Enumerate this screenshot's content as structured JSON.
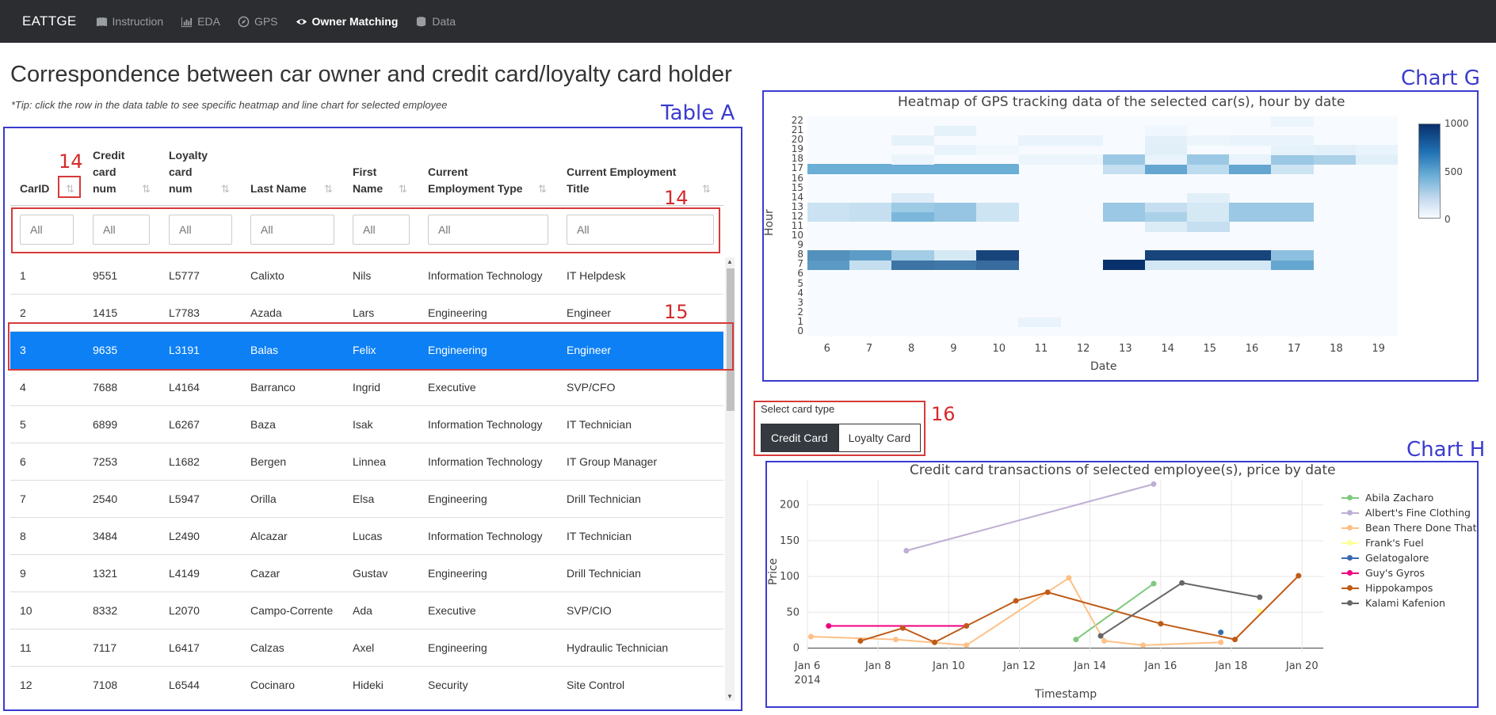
{
  "navbar": {
    "brand": "EATTGE",
    "items": [
      {
        "label": "Instruction",
        "icon": "book-icon",
        "active": false
      },
      {
        "label": "EDA",
        "icon": "chart-icon",
        "active": false
      },
      {
        "label": "GPS",
        "icon": "compass-icon",
        "active": false
      },
      {
        "label": "Owner Matching",
        "icon": "eye-icon",
        "active": true
      },
      {
        "label": "Data",
        "icon": "database-icon",
        "active": false
      }
    ]
  },
  "page": {
    "title": "Correspondence between car owner and credit card/loyalty card holder",
    "tip": "*Tip: click the row in the data table to see specific heatmap and line chart for selected employee"
  },
  "annotations": {
    "table_a": "Table A",
    "chart_g": "Chart G",
    "chart_h": "Chart H",
    "n14a": "14",
    "n14b": "14",
    "n15": "15",
    "n16": "16"
  },
  "table": {
    "columns": [
      {
        "label": "CarID"
      },
      {
        "label": "Credit card num"
      },
      {
        "label": "Loyalty card num"
      },
      {
        "label": "Last Name"
      },
      {
        "label": "First Name"
      },
      {
        "label": "Current Employment Type"
      },
      {
        "label": "Current Employment Title"
      }
    ],
    "filter_placeholder": "All",
    "selected_row": 2,
    "rows": [
      [
        "1",
        "9551",
        "L5777",
        "Calixto",
        "Nils",
        "Information Technology",
        "IT Helpdesk"
      ],
      [
        "2",
        "1415",
        "L7783",
        "Azada",
        "Lars",
        "Engineering",
        "Engineer"
      ],
      [
        "3",
        "9635",
        "L3191",
        "Balas",
        "Felix",
        "Engineering",
        "Engineer"
      ],
      [
        "4",
        "7688",
        "L4164",
        "Barranco",
        "Ingrid",
        "Executive",
        "SVP/CFO"
      ],
      [
        "5",
        "6899",
        "L6267",
        "Baza",
        "Isak",
        "Information Technology",
        "IT Technician"
      ],
      [
        "6",
        "7253",
        "L1682",
        "Bergen",
        "Linnea",
        "Information Technology",
        "IT Group Manager"
      ],
      [
        "7",
        "2540",
        "L5947",
        "Orilla",
        "Elsa",
        "Engineering",
        "Drill Technician"
      ],
      [
        "8",
        "3484",
        "L2490",
        "Alcazar",
        "Lucas",
        "Information Technology",
        "IT Technician"
      ],
      [
        "9",
        "1321",
        "L4149",
        "Cazar",
        "Gustav",
        "Engineering",
        "Drill Technician"
      ],
      [
        "10",
        "8332",
        "L2070",
        "Campo-Corrente",
        "Ada",
        "Executive",
        "SVP/CIO"
      ],
      [
        "11",
        "7117",
        "L6417",
        "Calzas",
        "Axel",
        "Engineering",
        "Hydraulic Technician"
      ],
      [
        "12",
        "7108",
        "L6544",
        "Cocinaro",
        "Hideki",
        "Security",
        "Site Control"
      ]
    ]
  },
  "card_select": {
    "label": "Select card type",
    "options": [
      "Credit Card",
      "Loyalty Card"
    ],
    "selected": "Credit Card"
  },
  "chart_data": [
    {
      "type": "heatmap",
      "title": "Heatmap of GPS tracking data of the selected car(s), hour by date",
      "xlabel": "Date",
      "ylabel": "Hour",
      "x": [
        6,
        7,
        8,
        9,
        10,
        11,
        12,
        13,
        14,
        15,
        16,
        17,
        18,
        19
      ],
      "y": [
        0,
        1,
        2,
        3,
        4,
        5,
        6,
        7,
        8,
        9,
        10,
        11,
        12,
        13,
        14,
        15,
        16,
        17,
        18,
        19,
        20,
        21,
        22
      ],
      "colorscale": [
        "#f7fbff",
        "#08306b"
      ],
      "zrange": [
        0,
        1000
      ],
      "colorbar_ticks": [
        "1000",
        "500",
        "0"
      ],
      "z": [
        [
          0,
          0,
          0,
          0,
          0,
          0,
          0,
          0,
          0,
          0,
          0,
          0,
          0,
          0
        ],
        [
          0,
          0,
          0,
          0,
          0,
          50,
          0,
          0,
          0,
          0,
          0,
          0,
          0,
          0
        ],
        [
          0,
          0,
          0,
          0,
          0,
          0,
          0,
          0,
          0,
          0,
          0,
          0,
          0,
          0
        ],
        [
          0,
          0,
          0,
          0,
          0,
          0,
          0,
          0,
          0,
          0,
          0,
          0,
          0,
          0
        ],
        [
          0,
          0,
          0,
          0,
          0,
          0,
          0,
          0,
          0,
          0,
          0,
          0,
          0,
          0
        ],
        [
          0,
          0,
          0,
          0,
          0,
          0,
          0,
          0,
          0,
          0,
          0,
          0,
          0,
          0
        ],
        [
          0,
          0,
          0,
          0,
          0,
          0,
          0,
          0,
          0,
          0,
          0,
          0,
          0,
          0
        ],
        [
          580,
          180,
          730,
          720,
          760,
          0,
          0,
          1000,
          130,
          130,
          130,
          530,
          0,
          0
        ],
        [
          620,
          570,
          300,
          120,
          920,
          0,
          0,
          0,
          920,
          920,
          920,
          380,
          0,
          0
        ],
        [
          0,
          0,
          0,
          0,
          0,
          0,
          0,
          0,
          0,
          0,
          0,
          0,
          0,
          0
        ],
        [
          0,
          0,
          0,
          0,
          0,
          0,
          0,
          0,
          0,
          0,
          0,
          0,
          0,
          0
        ],
        [
          0,
          0,
          0,
          0,
          0,
          0,
          0,
          0,
          100,
          180,
          0,
          0,
          0,
          0
        ],
        [
          160,
          180,
          440,
          350,
          150,
          0,
          0,
          330,
          270,
          120,
          330,
          330,
          0,
          0
        ],
        [
          160,
          180,
          320,
          350,
          150,
          0,
          0,
          330,
          180,
          120,
          330,
          330,
          0,
          0
        ],
        [
          0,
          0,
          90,
          0,
          0,
          0,
          0,
          0,
          0,
          80,
          0,
          0,
          0,
          0
        ],
        [
          0,
          0,
          0,
          0,
          0,
          0,
          0,
          0,
          0,
          0,
          0,
          0,
          0,
          0
        ],
        [
          0,
          0,
          0,
          0,
          0,
          0,
          0,
          0,
          0,
          0,
          0,
          0,
          0,
          0
        ],
        [
          500,
          500,
          500,
          500,
          500,
          0,
          0,
          180,
          530,
          210,
          530,
          150,
          0,
          0
        ],
        [
          0,
          0,
          40,
          0,
          0,
          40,
          40,
          330,
          50,
          330,
          50,
          330,
          270,
          80
        ],
        [
          0,
          0,
          0,
          50,
          20,
          0,
          0,
          0,
          80,
          0,
          0,
          60,
          70,
          50
        ],
        [
          0,
          0,
          60,
          0,
          0,
          50,
          50,
          0,
          70,
          40,
          50,
          50,
          0,
          0
        ],
        [
          0,
          0,
          0,
          60,
          0,
          0,
          0,
          0,
          30,
          0,
          0,
          0,
          0,
          0
        ],
        [
          0,
          0,
          0,
          0,
          0,
          0,
          0,
          0,
          0,
          0,
          0,
          40,
          0,
          0
        ]
      ]
    },
    {
      "type": "line",
      "title": "Credit card transactions of selected employee(s), price by date",
      "xlabel": "Timestamp",
      "ylabel": "Price",
      "x_ticks": [
        "Jan 6",
        "Jan 8",
        "Jan 10",
        "Jan 12",
        "Jan 14",
        "Jan 16",
        "Jan 18",
        "Jan 20"
      ],
      "x_tick_sub": "2014",
      "x_range": [
        6,
        20.6
      ],
      "y_ticks": [
        0,
        50,
        100,
        150,
        200
      ],
      "y_range": [
        -5,
        235
      ],
      "series": [
        {
          "name": "Abila Zacharo",
          "color": "#7fc97f",
          "points": [
            [
              13.6,
              12
            ],
            [
              15.8,
              90
            ]
          ]
        },
        {
          "name": "Albert's Fine Clothing",
          "color": "#beaed4",
          "points": [
            [
              8.8,
              136
            ],
            [
              15.8,
              229
            ]
          ]
        },
        {
          "name": "Bean There Done That",
          "color": "#fdc086",
          "points": [
            [
              6.1,
              16
            ],
            [
              8.5,
              12
            ],
            [
              10.5,
              4
            ],
            [
              13.4,
              98
            ],
            [
              14.4,
              10
            ],
            [
              15.5,
              4
            ],
            [
              17.7,
              8
            ]
          ]
        },
        {
          "name": "Frank's Fuel",
          "color": "#ffff99",
          "points": [
            [
              18.8,
              52
            ]
          ]
        },
        {
          "name": "Gelatogalore",
          "color": "#386cb0",
          "points": [
            [
              17.7,
              22
            ]
          ]
        },
        {
          "name": "Guy's Gyros",
          "color": "#f0027f",
          "points": [
            [
              6.6,
              31
            ],
            [
              10.5,
              31
            ]
          ]
        },
        {
          "name": "Hippokampos",
          "color": "#bf5b17",
          "points": [
            [
              7.5,
              10
            ],
            [
              8.7,
              28
            ],
            [
              9.6,
              8
            ],
            [
              10.5,
              31
            ],
            [
              11.9,
              66
            ],
            [
              12.8,
              78
            ],
            [
              16.0,
              34
            ],
            [
              18.1,
              12
            ],
            [
              19.9,
              101
            ]
          ]
        },
        {
          "name": "Kalami Kafenion",
          "color": "#666666",
          "points": [
            [
              14.3,
              17
            ],
            [
              16.6,
              91
            ],
            [
              18.8,
              71
            ]
          ]
        }
      ]
    }
  ]
}
